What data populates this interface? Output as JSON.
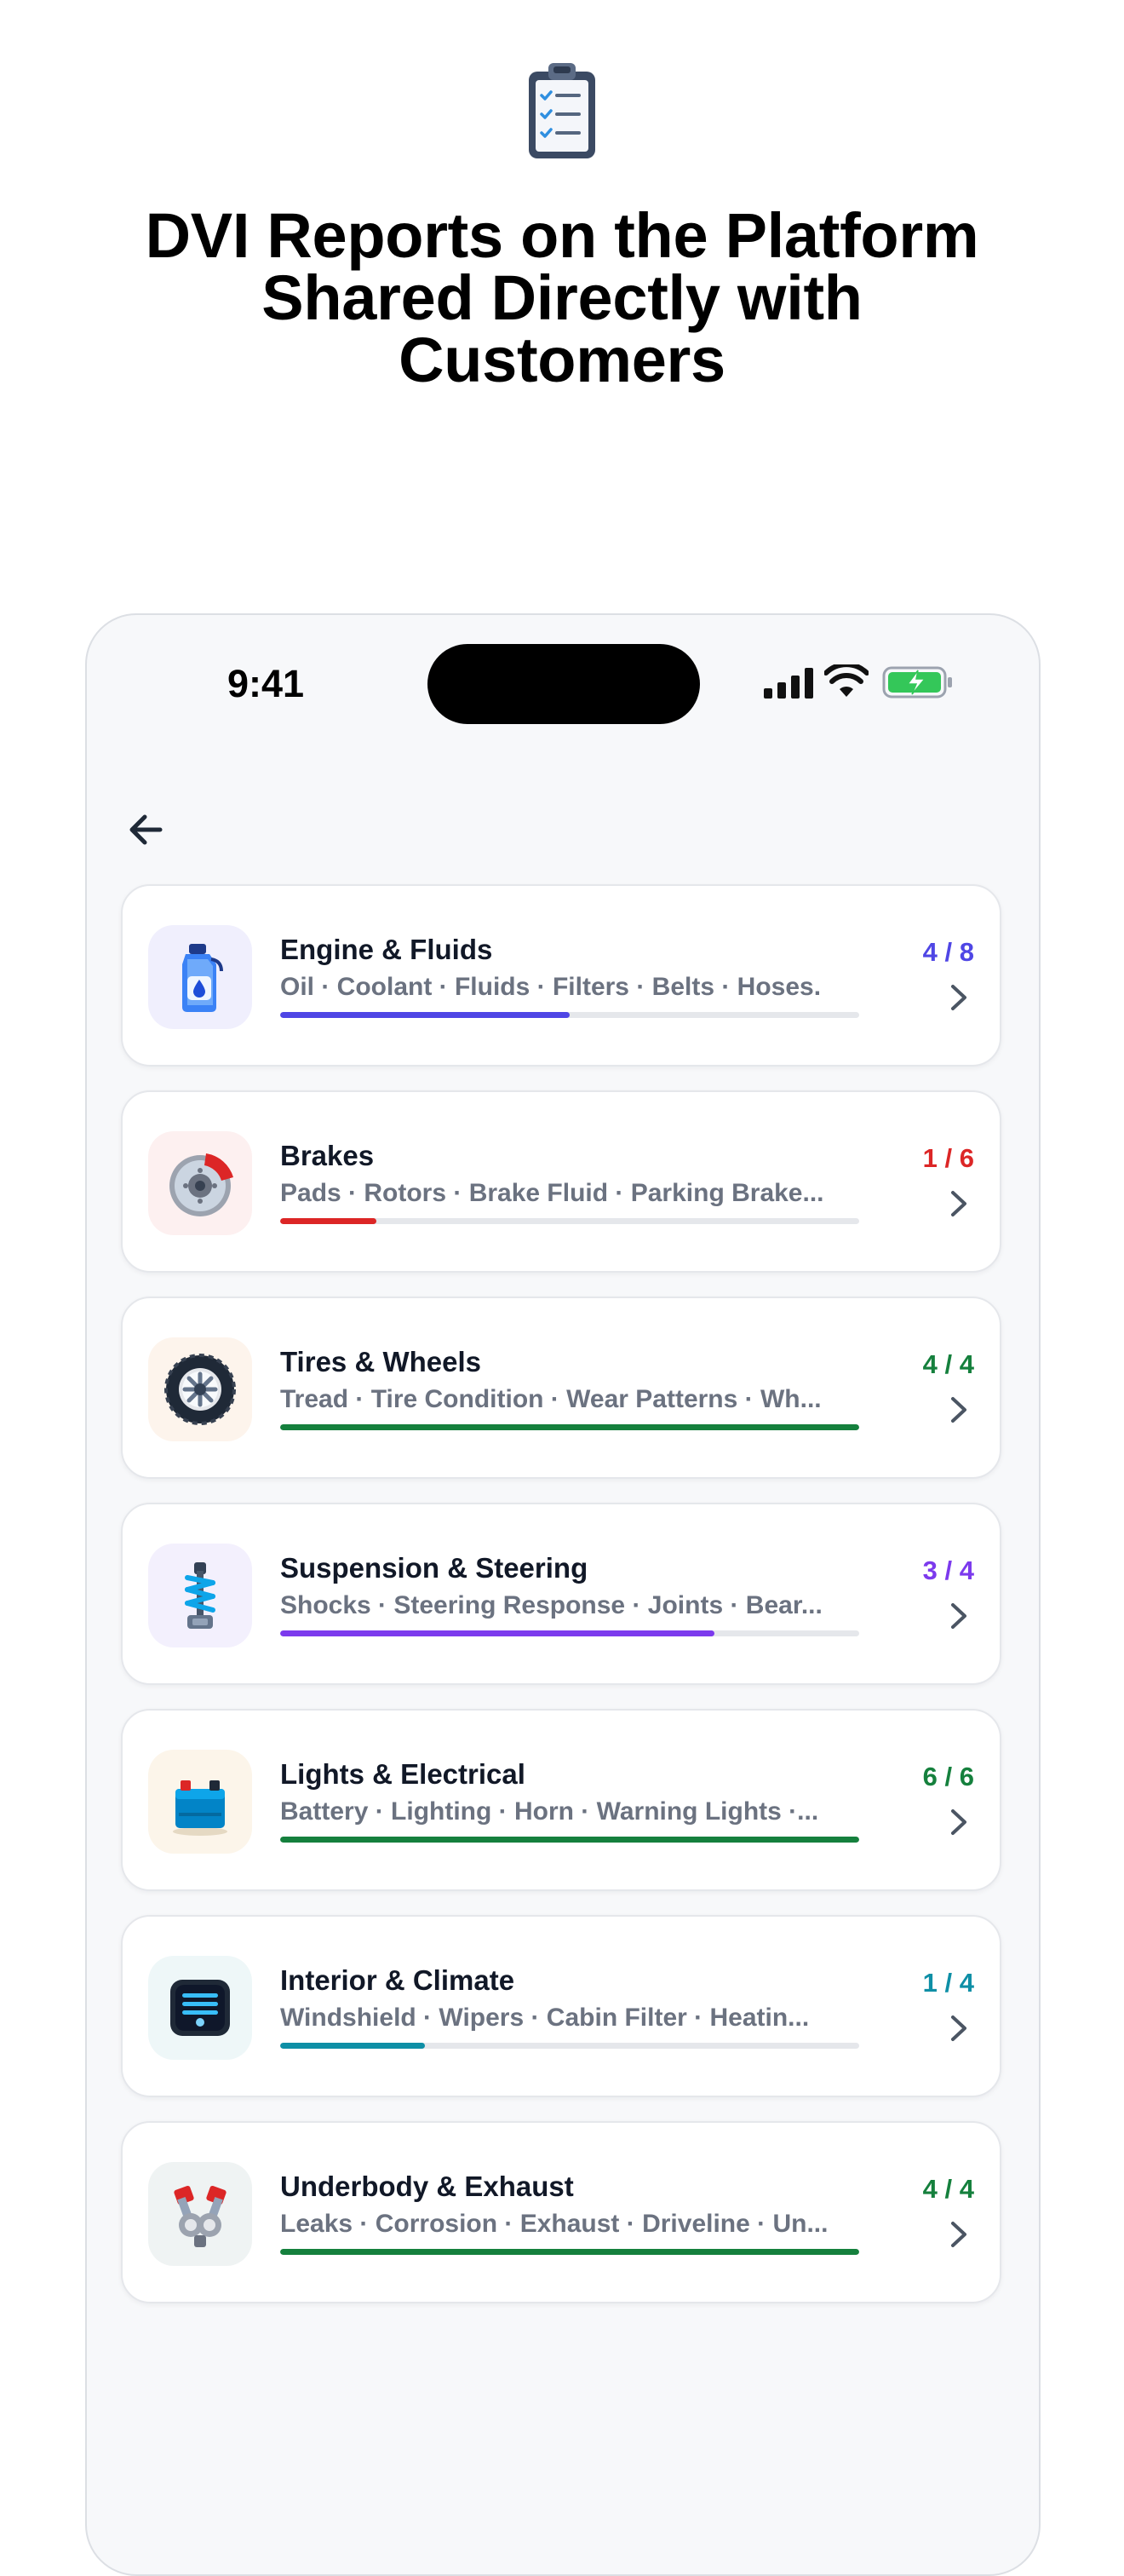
{
  "header": {
    "title_line1": "DVI Reports on the Platform",
    "title_line2": "Shared Directly with",
    "title_line3": "Customers",
    "icon": "clipboard-checklist-icon"
  },
  "status_bar": {
    "time": "9:41",
    "icons": [
      "signal-icon",
      "wifi-icon",
      "battery-charging-icon"
    ]
  },
  "nav": {
    "back_icon": "back-arrow-icon"
  },
  "colors": {
    "page_background": "#ffffff",
    "phone_background": "#f7f8fa",
    "card_background": "#ffffff",
    "title_text": "#111827",
    "subtitle_text": "#6b7280",
    "track": "#e5e7eb"
  },
  "categories": [
    {
      "title": "Engine & Fluids",
      "subtitle": "Oil · Coolant · Fluids · Filters · Belts · Hoses.",
      "count": "4 / 8",
      "progress": 0.5,
      "color": "#4f46e5",
      "icon": "engine-oil-bottle-icon",
      "icon_bg": "#f0effd"
    },
    {
      "title": "Brakes",
      "subtitle": "Pads · Rotors · Brake Fluid · Parking Brake...",
      "count": "1 / 6",
      "progress": 0.1667,
      "color": "#dc2626",
      "icon": "brake-disc-icon",
      "icon_bg": "#fdf0f0"
    },
    {
      "title": "Tires & Wheels",
      "subtitle": "Tread · Tire Condition · Wear Patterns · Wh...",
      "count": "4 / 4",
      "progress": 1.0,
      "color": "#15803d",
      "icon": "tire-wheel-icon",
      "icon_bg": "#fdf4ec"
    },
    {
      "title": "Suspension & Steering",
      "subtitle": "Shocks · Steering Response · Joints · Bear...",
      "count": "3 / 4",
      "progress": 0.75,
      "color": "#7c3aed",
      "icon": "suspension-spring-icon",
      "icon_bg": "#f3f0fd"
    },
    {
      "title": "Lights & Electrical",
      "subtitle": "Battery · Lighting · Horn · Warning Lights ·...",
      "count": "6 / 6",
      "progress": 1.0,
      "color": "#15803d",
      "icon": "car-battery-icon",
      "icon_bg": "#fcf5ea"
    },
    {
      "title": "Interior & Climate",
      "subtitle": "Windshield · Wipers · Cabin Filter · Heatin...",
      "count": "1 / 4",
      "progress": 0.25,
      "color": "#0e8fa6",
      "icon": "climate-control-icon",
      "icon_bg": "#eef7f8"
    },
    {
      "title": "Underbody & Exhaust",
      "subtitle": "Leaks · Corrosion · Exhaust · Driveline · Un...",
      "count": "4 / 4",
      "progress": 1.0,
      "color": "#15803d",
      "icon": "exhaust-manifold-icon",
      "icon_bg": "#eff3f3"
    }
  ]
}
